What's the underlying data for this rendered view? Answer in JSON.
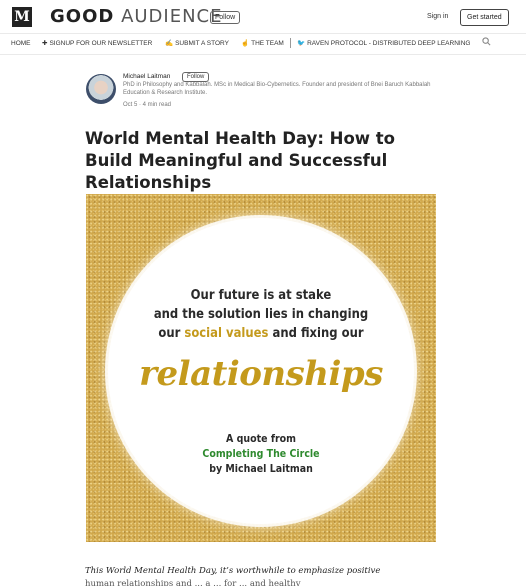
{
  "header": {
    "logo": "M",
    "publication_part1": "GOOD",
    "publication_part2": "AUDIENCE",
    "follow_label": "Follow",
    "signin_label": "Sign in",
    "get_started_label": "Get started"
  },
  "nav": {
    "items": [
      {
        "label": "HOME",
        "icon": ""
      },
      {
        "label": "SIGNUP FOR OUR NEWSLETTER",
        "icon": "✚"
      },
      {
        "label": "SUBMIT A STORY",
        "icon": "✍"
      },
      {
        "label": "THE TEAM",
        "icon": "☝"
      },
      {
        "label": "RAVEN PROTOCOL - DISTRIBUTED DEEP LEARNING",
        "icon": "🐦"
      }
    ],
    "search_icon": "search-icon"
  },
  "author": {
    "name": "Michael Laitman",
    "follow_label": "Follow",
    "bio": "PhD in Philosophy and Kabbalah. MSc in Medical Bio-Cybernetics. Founder and president of Bnei Baruch Kabbalah Education & Research Institute.",
    "meta": "Oct 5 · 4 min read"
  },
  "article": {
    "title": "World Mental Health Day: How to Build Meaningful and Successful Relationships",
    "intro": "This World Mental Health Day, it’s worthwhile to emphasize positive",
    "intro_line2": "human relationships and ... a ... for ... and healthy"
  },
  "hero_image": {
    "quote_line1": "Our future is at stake",
    "quote_line2": "and the solution lies in changing",
    "quote_line3_pre": "our ",
    "quote_line3_hl": "social values",
    "quote_line3_post": " and fixing our",
    "script_word": "relationships",
    "credit_line1": "A quote from",
    "credit_book": "Completing The Circle",
    "credit_line3": "by Michael Laitman",
    "colors": {
      "gold": "#c49a1c",
      "green": "#2e8a2e",
      "background": "#d0a84c"
    }
  }
}
